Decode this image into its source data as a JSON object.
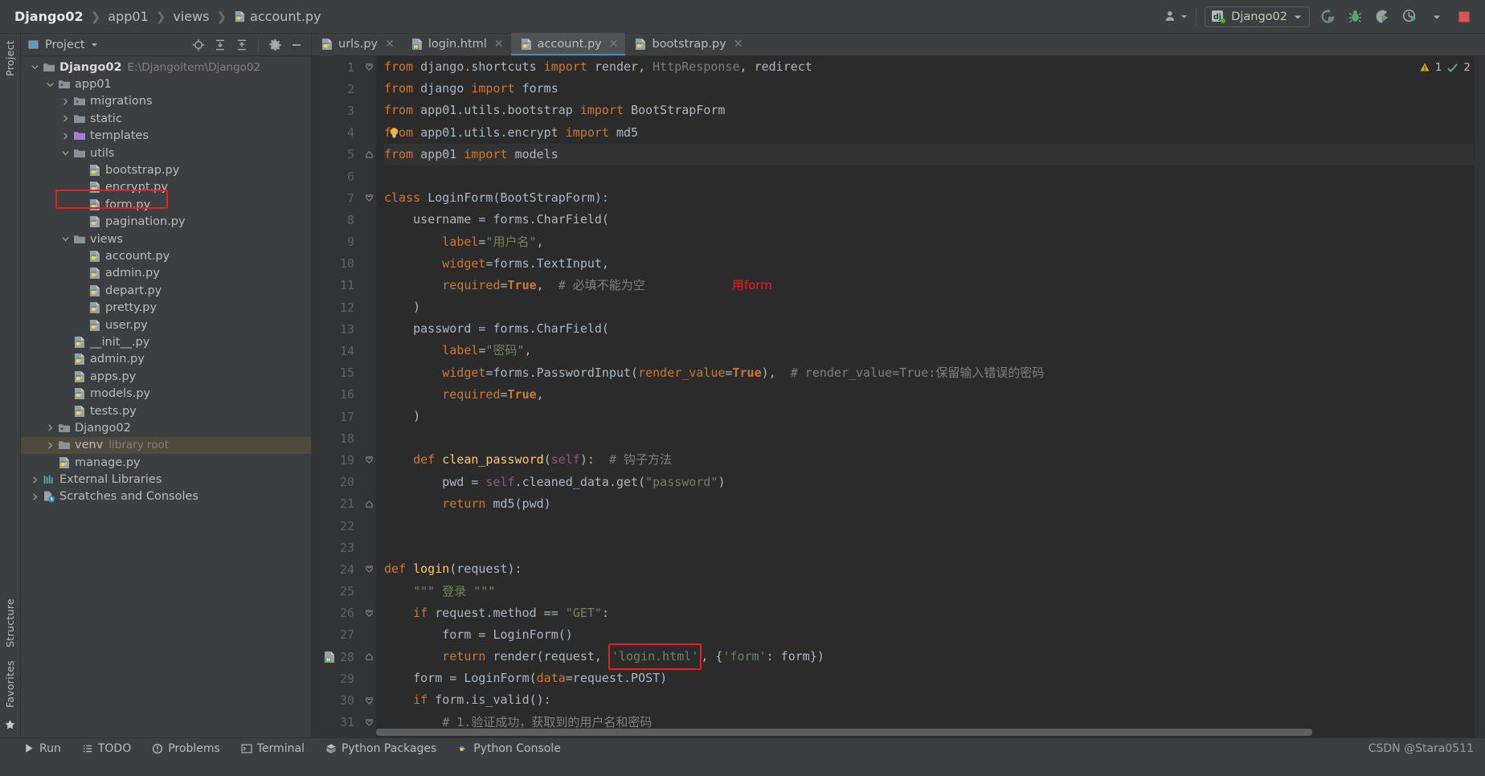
{
  "window": {
    "breadcrumb": [
      "Django02",
      "app01",
      "views",
      "account.py"
    ],
    "breadcrumb_file_icon": "python-file-icon"
  },
  "toolbar": {
    "user_icon": "user-icon",
    "dropdown_icon": "chevron-down-icon",
    "run_config_name": "Django02",
    "run_config_icon": "django-icon",
    "buttons": [
      {
        "name": "rerun-button",
        "icon": "rerun-icon"
      },
      {
        "name": "debug-button",
        "icon": "bug-icon"
      },
      {
        "name": "run-coverage-button",
        "icon": "coverage-icon"
      },
      {
        "name": "profile-button",
        "icon": "profile-icon"
      },
      {
        "name": "more-run-options",
        "icon": "chevron-down-icon"
      },
      {
        "name": "stop-button",
        "icon": "stop-icon"
      }
    ]
  },
  "left_strip": {
    "tabs": [
      "Project",
      "Structure",
      "Favorites"
    ],
    "bookmark_icon": "star-icon"
  },
  "project_panel": {
    "title": "Project",
    "title_dropdown_icon": "chevron-down-icon",
    "header_icons": [
      {
        "name": "locate-file-icon",
        "icon": "crosshair-icon"
      },
      {
        "name": "expand-all-icon",
        "icon": "expand-all-icon"
      },
      {
        "name": "collapse-all-icon",
        "icon": "collapse-all-icon"
      },
      {
        "name": "settings-icon",
        "icon": "gear-icon"
      },
      {
        "name": "hide-panel-icon",
        "icon": "minus-icon"
      }
    ],
    "tree": [
      {
        "label": "Django02",
        "sub": "E:\\Djangoitem\\Django02",
        "depth": 0,
        "icon": "folder-root-icon",
        "arrow": "down",
        "bold": true
      },
      {
        "label": "app01",
        "sub": "",
        "depth": 1,
        "icon": "folder-module-icon",
        "arrow": "down",
        "bold": false
      },
      {
        "label": "migrations",
        "sub": "",
        "depth": 2,
        "icon": "folder-module-icon",
        "arrow": "right",
        "bold": false
      },
      {
        "label": "static",
        "sub": "",
        "depth": 2,
        "icon": "folder-icon",
        "arrow": "right",
        "bold": false
      },
      {
        "label": "templates",
        "sub": "",
        "depth": 2,
        "icon": "folder-templates-icon",
        "arrow": "right",
        "bold": false
      },
      {
        "label": "utils",
        "sub": "",
        "depth": 2,
        "icon": "folder-icon",
        "arrow": "down",
        "bold": false
      },
      {
        "label": "bootstrap.py",
        "sub": "",
        "depth": 3,
        "icon": "python-file-icon",
        "arrow": "",
        "bold": false
      },
      {
        "label": "encrypt.py",
        "sub": "",
        "depth": 3,
        "icon": "python-file-icon",
        "arrow": "",
        "bold": false
      },
      {
        "label": "form.py",
        "sub": "",
        "depth": 3,
        "icon": "python-file-icon",
        "arrow": "",
        "bold": false
      },
      {
        "label": "pagination.py",
        "sub": "",
        "depth": 3,
        "icon": "python-file-icon",
        "arrow": "",
        "bold": false
      },
      {
        "label": "views",
        "sub": "",
        "depth": 2,
        "icon": "folder-icon",
        "arrow": "down",
        "bold": false
      },
      {
        "label": "account.py",
        "sub": "",
        "depth": 3,
        "icon": "python-file-icon",
        "arrow": "",
        "bold": false,
        "highlight_box": true
      },
      {
        "label": "admin.py",
        "sub": "",
        "depth": 3,
        "icon": "python-file-icon",
        "arrow": "",
        "bold": false
      },
      {
        "label": "depart.py",
        "sub": "",
        "depth": 3,
        "icon": "python-file-icon",
        "arrow": "",
        "bold": false
      },
      {
        "label": "pretty.py",
        "sub": "",
        "depth": 3,
        "icon": "python-file-icon",
        "arrow": "",
        "bold": false
      },
      {
        "label": "user.py",
        "sub": "",
        "depth": 3,
        "icon": "python-file-icon",
        "arrow": "",
        "bold": false
      },
      {
        "label": "__init__.py",
        "sub": "",
        "depth": 2,
        "icon": "python-file-icon",
        "arrow": "",
        "bold": false
      },
      {
        "label": "admin.py",
        "sub": "",
        "depth": 2,
        "icon": "python-file-icon",
        "arrow": "",
        "bold": false
      },
      {
        "label": "apps.py",
        "sub": "",
        "depth": 2,
        "icon": "python-file-icon",
        "arrow": "",
        "bold": false
      },
      {
        "label": "models.py",
        "sub": "",
        "depth": 2,
        "icon": "python-file-icon",
        "arrow": "",
        "bold": false
      },
      {
        "label": "tests.py",
        "sub": "",
        "depth": 2,
        "icon": "python-file-icon",
        "arrow": "",
        "bold": false
      },
      {
        "label": "Django02",
        "sub": "",
        "depth": 1,
        "icon": "folder-module-icon",
        "arrow": "right",
        "bold": false
      },
      {
        "label": "venv",
        "sub": "library root",
        "depth": 1,
        "icon": "folder-icon",
        "arrow": "right",
        "bold": false,
        "selected": true
      },
      {
        "label": "manage.py",
        "sub": "",
        "depth": 1,
        "icon": "python-file-icon",
        "arrow": "",
        "bold": false
      },
      {
        "label": "External Libraries",
        "sub": "",
        "depth": 0,
        "icon": "libraries-icon",
        "arrow": "right",
        "bold": false
      },
      {
        "label": "Scratches and Consoles",
        "sub": "",
        "depth": 0,
        "icon": "scratches-icon",
        "arrow": "right",
        "bold": false
      }
    ]
  },
  "editor": {
    "tabs": [
      {
        "label": "urls.py",
        "icon": "python-file-icon",
        "active": false
      },
      {
        "label": "login.html",
        "icon": "html-file-icon",
        "active": false
      },
      {
        "label": "account.py",
        "icon": "python-file-icon",
        "active": true
      },
      {
        "label": "bootstrap.py",
        "icon": "python-file-icon",
        "active": false
      }
    ],
    "inspections": {
      "warning_count": "1",
      "ok_count": "2",
      "warning_icon": "warning-triangle-icon",
      "ok_icon": "checkmark-icon"
    },
    "current_line": 5,
    "lines": [
      {
        "n": "1",
        "fold": "start",
        "tokens": [
          {
            "t": "from ",
            "c": "kw"
          },
          {
            "t": "django.shortcuts ",
            "c": "txt"
          },
          {
            "t": "import ",
            "c": "kw"
          },
          {
            "t": "render",
            "c": "txt"
          },
          {
            "t": ", ",
            "c": "txt"
          },
          {
            "t": "HttpResponse",
            "c": "dim"
          },
          {
            "t": ", ",
            "c": "txt"
          },
          {
            "t": "redirect",
            "c": "txt"
          }
        ]
      },
      {
        "n": "2",
        "fold": "",
        "tokens": [
          {
            "t": "from ",
            "c": "kw"
          },
          {
            "t": "django ",
            "c": "txt"
          },
          {
            "t": "import ",
            "c": "kw"
          },
          {
            "t": "forms",
            "c": "txt"
          }
        ]
      },
      {
        "n": "3",
        "fold": "",
        "tokens": [
          {
            "t": "from ",
            "c": "kw"
          },
          {
            "t": "app01.utils.bootstrap ",
            "c": "txt"
          },
          {
            "t": "import ",
            "c": "kw"
          },
          {
            "t": "BootStrapForm",
            "c": "txt"
          }
        ]
      },
      {
        "n": "4",
        "fold": "",
        "tokens": [
          {
            "t": "from ",
            "c": "kw"
          },
          {
            "t": "app01.utils.encrypt ",
            "c": "txt"
          },
          {
            "t": "import ",
            "c": "kw"
          },
          {
            "t": "md5",
            "c": "txt"
          }
        ],
        "bulb": true
      },
      {
        "n": "5",
        "fold": "end",
        "tokens": [
          {
            "t": "from ",
            "c": "kw"
          },
          {
            "t": "app01 ",
            "c": "txt"
          },
          {
            "t": "import ",
            "c": "kw"
          },
          {
            "t": "models",
            "c": "txt"
          }
        ],
        "current": true
      },
      {
        "n": "6",
        "fold": "",
        "tokens": []
      },
      {
        "n": "7",
        "fold": "start",
        "tokens": [
          {
            "t": "class ",
            "c": "kw"
          },
          {
            "t": "LoginForm",
            "c": "txt"
          },
          {
            "t": "(",
            "c": "txt"
          },
          {
            "t": "BootStrapForm",
            "c": "txt"
          },
          {
            "t": "):",
            "c": "txt"
          }
        ]
      },
      {
        "n": "8",
        "fold": "",
        "tokens": [
          {
            "t": "    username = forms.CharField(",
            "c": "txt"
          }
        ]
      },
      {
        "n": "9",
        "fold": "",
        "tokens": [
          {
            "t": "        ",
            "c": "txt"
          },
          {
            "t": "label",
            "c": "kwarg"
          },
          {
            "t": "=",
            "c": "txt"
          },
          {
            "t": "\"用户名\"",
            "c": "str"
          },
          {
            "t": ",",
            "c": "txt"
          }
        ]
      },
      {
        "n": "10",
        "fold": "",
        "tokens": [
          {
            "t": "        ",
            "c": "txt"
          },
          {
            "t": "widget",
            "c": "kwarg"
          },
          {
            "t": "=forms.TextInput,",
            "c": "txt"
          }
        ]
      },
      {
        "n": "11",
        "fold": "",
        "tokens": [
          {
            "t": "        ",
            "c": "txt"
          },
          {
            "t": "required",
            "c": "kwarg"
          },
          {
            "t": "=",
            "c": "txt"
          },
          {
            "t": "True",
            "c": "kw2"
          },
          {
            "t": ",  ",
            "c": "txt"
          },
          {
            "t": "# 必填不能为空",
            "c": "cmt"
          }
        ],
        "annotation": "用form"
      },
      {
        "n": "12",
        "fold": "",
        "tokens": [
          {
            "t": "    )",
            "c": "txt"
          }
        ]
      },
      {
        "n": "13",
        "fold": "",
        "tokens": [
          {
            "t": "    password = forms.CharField(",
            "c": "txt"
          }
        ]
      },
      {
        "n": "14",
        "fold": "",
        "tokens": [
          {
            "t": "        ",
            "c": "txt"
          },
          {
            "t": "label",
            "c": "kwarg"
          },
          {
            "t": "=",
            "c": "txt"
          },
          {
            "t": "\"密码\"",
            "c": "str"
          },
          {
            "t": ",",
            "c": "txt"
          }
        ]
      },
      {
        "n": "15",
        "fold": "",
        "tokens": [
          {
            "t": "        ",
            "c": "txt"
          },
          {
            "t": "widget",
            "c": "kwarg"
          },
          {
            "t": "=forms.PasswordInput(",
            "c": "txt"
          },
          {
            "t": "render_value",
            "c": "kwarg"
          },
          {
            "t": "=",
            "c": "txt"
          },
          {
            "t": "True",
            "c": "kw2"
          },
          {
            "t": "),  ",
            "c": "txt"
          },
          {
            "t": "# render_value=True:保留输入错误的密码",
            "c": "cmt"
          }
        ]
      },
      {
        "n": "16",
        "fold": "",
        "tokens": [
          {
            "t": "        ",
            "c": "txt"
          },
          {
            "t": "required",
            "c": "kwarg"
          },
          {
            "t": "=",
            "c": "txt"
          },
          {
            "t": "True",
            "c": "kw2"
          },
          {
            "t": ",",
            "c": "txt"
          }
        ]
      },
      {
        "n": "17",
        "fold": "",
        "tokens": [
          {
            "t": "    )",
            "c": "txt"
          }
        ]
      },
      {
        "n": "18",
        "fold": "",
        "tokens": []
      },
      {
        "n": "19",
        "fold": "start",
        "tokens": [
          {
            "t": "    ",
            "c": "txt"
          },
          {
            "t": "def ",
            "c": "kw"
          },
          {
            "t": "clean_password",
            "c": "def"
          },
          {
            "t": "(",
            "c": "txt"
          },
          {
            "t": "self",
            "c": "self"
          },
          {
            "t": "):  ",
            "c": "txt"
          },
          {
            "t": "# 钩子方法",
            "c": "cmt"
          }
        ]
      },
      {
        "n": "20",
        "fold": "",
        "tokens": [
          {
            "t": "        pwd = ",
            "c": "txt"
          },
          {
            "t": "self",
            "c": "self"
          },
          {
            "t": ".cleaned_data.get(",
            "c": "txt"
          },
          {
            "t": "\"password\"",
            "c": "str"
          },
          {
            "t": ")",
            "c": "txt"
          }
        ]
      },
      {
        "n": "21",
        "fold": "end",
        "tokens": [
          {
            "t": "        ",
            "c": "txt"
          },
          {
            "t": "return ",
            "c": "kw"
          },
          {
            "t": "md5(pwd)",
            "c": "txt"
          }
        ]
      },
      {
        "n": "22",
        "fold": "",
        "tokens": []
      },
      {
        "n": "23",
        "fold": "",
        "tokens": []
      },
      {
        "n": "24",
        "fold": "start",
        "tokens": [
          {
            "t": "def ",
            "c": "kw"
          },
          {
            "t": "login",
            "c": "def"
          },
          {
            "t": "(request):",
            "c": "txt"
          }
        ]
      },
      {
        "n": "25",
        "fold": "",
        "tokens": [
          {
            "t": "    ",
            "c": "txt"
          },
          {
            "t": "\"\"\" 登录 \"\"\"",
            "c": "str"
          }
        ]
      },
      {
        "n": "26",
        "fold": "start",
        "tokens": [
          {
            "t": "    ",
            "c": "txt"
          },
          {
            "t": "if ",
            "c": "kw"
          },
          {
            "t": "request.method == ",
            "c": "txt"
          },
          {
            "t": "\"GET\"",
            "c": "str"
          },
          {
            "t": ":",
            "c": "txt"
          }
        ]
      },
      {
        "n": "27",
        "fold": "",
        "tokens": [
          {
            "t": "        form = LoginForm()",
            "c": "txt"
          }
        ]
      },
      {
        "n": "28",
        "fold": "end",
        "tokens": [
          {
            "t": "        ",
            "c": "txt"
          },
          {
            "t": "return ",
            "c": "kw"
          },
          {
            "t": "render(request, ",
            "c": "txt"
          },
          {
            "t": "'login.html'",
            "c": "str",
            "boxed": true
          },
          {
            "t": ", {",
            "c": "txt"
          },
          {
            "t": "'form'",
            "c": "str"
          },
          {
            "t": ": form})",
            "c": "txt"
          }
        ],
        "gutter_icon": "html-file-icon"
      },
      {
        "n": "29",
        "fold": "",
        "tokens": [
          {
            "t": "    form = LoginForm(",
            "c": "txt"
          },
          {
            "t": "data",
            "c": "kwarg"
          },
          {
            "t": "=request.POST)",
            "c": "txt"
          }
        ]
      },
      {
        "n": "30",
        "fold": "start",
        "tokens": [
          {
            "t": "    ",
            "c": "txt"
          },
          {
            "t": "if ",
            "c": "kw"
          },
          {
            "t": "form.is_valid():",
            "c": "txt"
          }
        ]
      },
      {
        "n": "31",
        "fold": "start",
        "tokens": [
          {
            "t": "        ",
            "c": "txt"
          },
          {
            "t": "# 1.验证成功，获取到的用户名和密码",
            "c": "cmt"
          }
        ]
      }
    ]
  },
  "bottom_bar": {
    "items": [
      {
        "label": "Run",
        "icon": "run-icon"
      },
      {
        "label": "TODO",
        "icon": "todo-icon"
      },
      {
        "label": "Problems",
        "icon": "problems-icon"
      },
      {
        "label": "Terminal",
        "icon": "terminal-icon"
      },
      {
        "label": "Python Packages",
        "icon": "packages-icon"
      },
      {
        "label": "Python Console",
        "icon": "console-icon"
      }
    ]
  },
  "watermark": "CSDN @Stara0511"
}
